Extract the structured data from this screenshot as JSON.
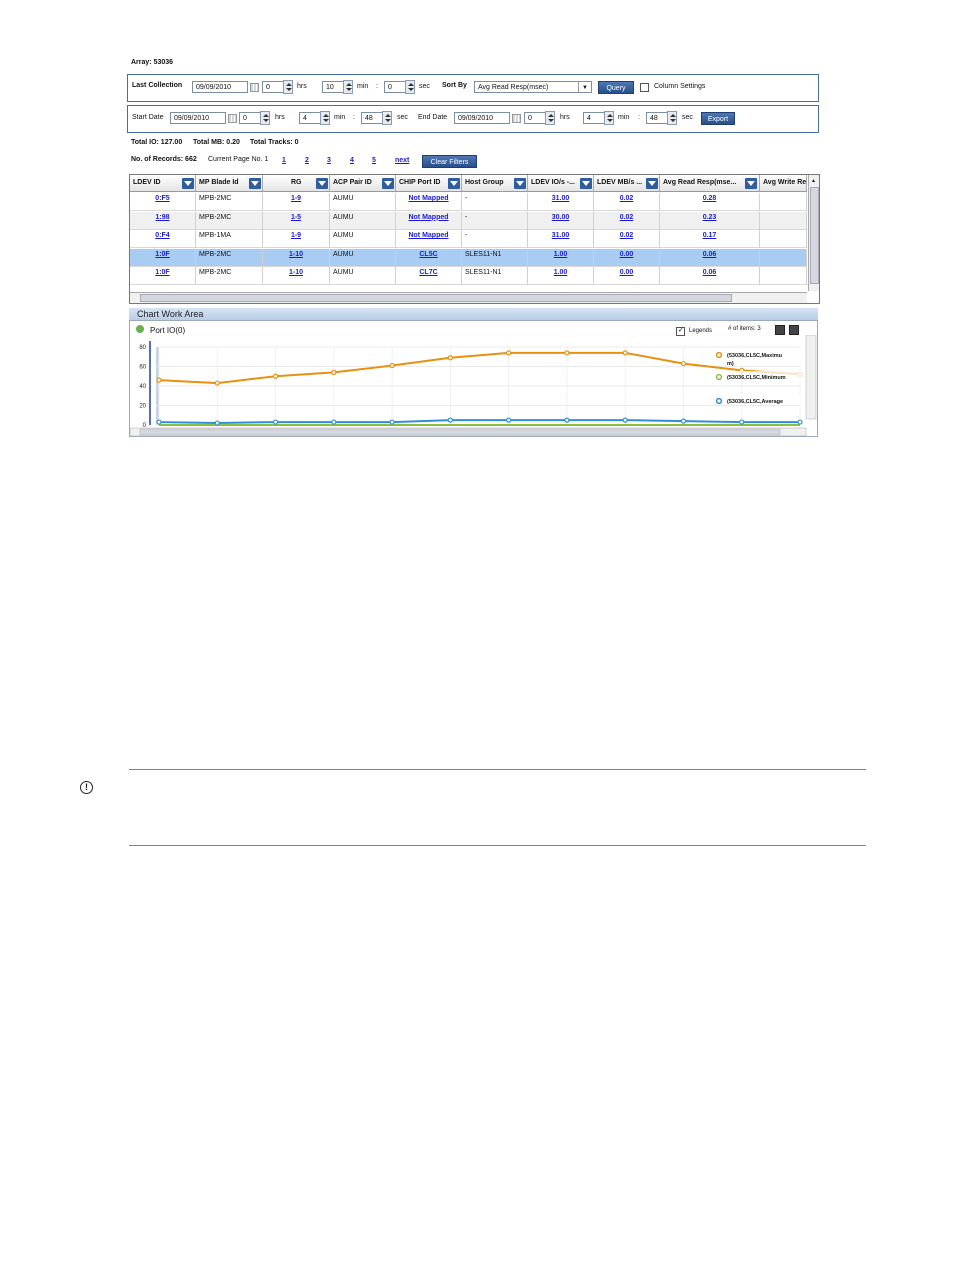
{
  "array_label": "Array: 53036",
  "last_collection": {
    "label": "Last Collection",
    "date": "09/09/2010",
    "hrs": "0",
    "hrs_label": "hrs",
    "min": "10",
    "min_label": "min",
    "sec": "0",
    "sec_label": "sec",
    "sort_by_label": "Sort By",
    "sort_by_value": "Avg Read Resp(msec)",
    "query_button": "Query",
    "column_settings_label": "Column Settings"
  },
  "range": {
    "start_label": "Start Date",
    "start_date": "09/09/2010",
    "start_hrs": "0",
    "start_min": "4",
    "start_sec": "48",
    "end_label": "End Date",
    "end_date": "09/09/2010",
    "end_hrs": "0",
    "end_min": "4",
    "end_sec": "48",
    "hrs_label": "hrs",
    "min_label": "min",
    "sec_label": "sec",
    "export_button": "Export"
  },
  "totals": {
    "io": "Total IO: 127.00",
    "mb": "Total MB: 0.20",
    "tracks": "Total Tracks: 0"
  },
  "paging": {
    "records": "No. of Records: 662",
    "current_page": "Current Page No. 1",
    "pages": [
      "1",
      "2",
      "3",
      "4",
      "5"
    ],
    "next": "next",
    "clear_filters": "Clear Filters"
  },
  "grid": {
    "columns": [
      "LDEV ID",
      "MP Blade Id",
      "RG",
      "ACP Pair ID",
      "CHIP Port ID",
      "Host Group",
      "LDEV IO/s -...",
      "LDEV MB/s ...",
      "Avg Read Resp(mse...",
      "Avg Write Re"
    ],
    "rows": [
      {
        "ldev": "0:F5",
        "mp": "MPB-2MC",
        "rg": "1-9",
        "acp": "AUMU",
        "port": "Not Mapped",
        "host": "-",
        "io": "31.00",
        "mb": "0.02",
        "resp": "0.28"
      },
      {
        "ldev": "1:98",
        "mp": "MPB-2MC",
        "rg": "1-5",
        "acp": "AUMU",
        "port": "Not Mapped",
        "host": "-",
        "io": "30.00",
        "mb": "0.02",
        "resp": "0.23"
      },
      {
        "ldev": "0:F4",
        "mp": "MPB-1MA",
        "rg": "1-9",
        "acp": "AUMU",
        "port": "Not Mapped",
        "host": "-",
        "io": "31.00",
        "mb": "0.02",
        "resp": "0.17"
      },
      {
        "ldev": "1:0F",
        "mp": "MPB-2MC",
        "rg": "1-10",
        "acp": "AUMU",
        "port": "CL5C",
        "host": "SLES11-N1",
        "io": "1.00",
        "mb": "0.00",
        "resp": "0.06"
      },
      {
        "ldev": "1:0F",
        "mp": "MPB-2MC",
        "rg": "1-10",
        "acp": "AUMU",
        "port": "CL7C",
        "host": "SLES11-N1",
        "io": "1.00",
        "mb": "0.00",
        "resp": "0.06"
      }
    ],
    "selected_row": 3
  },
  "chart_area": {
    "title": "Chart Work Area",
    "panel_title": "Port IO(0)",
    "legends_label": "Legends",
    "items_label": "# of items: 3"
  },
  "chart_data": {
    "type": "line",
    "title": "Port IO(0)",
    "ylim": [
      0,
      80
    ],
    "yticks": [
      "80",
      "60",
      "40",
      "20",
      "0"
    ],
    "grid": true,
    "legend_placement": "right",
    "series": [
      {
        "name": "(53036,CL5C,Maximum)",
        "color": "#e8900f",
        "values": [
          46,
          43,
          50,
          54,
          61,
          69,
          74,
          74,
          74,
          63,
          56,
          52
        ]
      },
      {
        "name": "(53036,CL5C,Minimum)",
        "color": "#8cbf3f",
        "values": [
          0,
          0,
          0,
          0,
          0,
          0,
          0,
          0,
          0,
          0,
          0,
          0
        ]
      },
      {
        "name": "(53036,CL5C,Average)",
        "color": "#2f8fd6",
        "values": [
          3,
          2,
          3,
          3,
          3,
          5,
          5,
          5,
          5,
          4,
          3,
          3
        ]
      }
    ],
    "legend_text": [
      "(53036,CL5C,Maximu\nm)",
      "(53036,CL5C,Minimum",
      "(53036,CL5C,Average"
    ]
  }
}
